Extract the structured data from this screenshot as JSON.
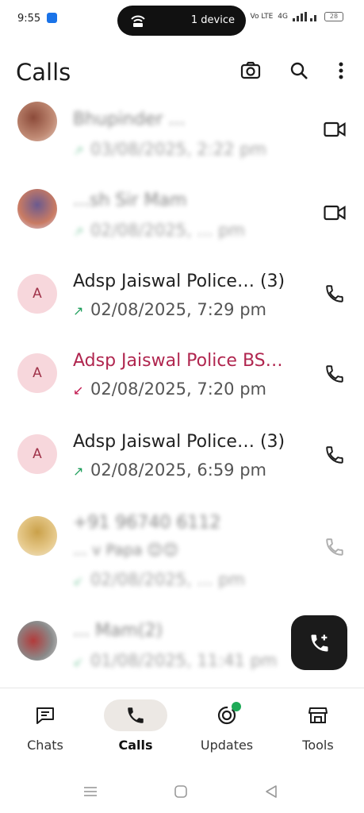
{
  "status_bar": {
    "time": "9:55",
    "pill_label": "1 device",
    "network": "Vo LTE",
    "signal": "4G",
    "battery": "28"
  },
  "app_bar": {
    "title": "Calls",
    "icons": [
      "camera-icon",
      "search-icon",
      "more-vert-icon"
    ]
  },
  "calls": [
    {
      "name": "Bhupinder ...",
      "detail": "03/08/2025, 2:22 pm",
      "type": "outgoing",
      "action": "video",
      "avatar": "photo",
      "obscured": true
    },
    {
      "name": "...sh Sir Mam",
      "detail": "02/08/2025, ... pm",
      "type": "outgoing",
      "action": "video",
      "avatar": "photo",
      "obscured": true
    },
    {
      "name": "Adsp Jaiswal Police… (3)",
      "detail": "02/08/2025, 7:29 pm",
      "type": "outgoing",
      "action": "voice",
      "avatar": "A",
      "obscured": false
    },
    {
      "name": "Adsp Jaiswal Police BS…",
      "detail": "02/08/2025, 7:20 pm",
      "type": "missed",
      "action": "voice",
      "avatar": "A",
      "obscured": false
    },
    {
      "name": "Adsp Jaiswal Police… (3)",
      "detail": "02/08/2025, 6:59 pm",
      "type": "outgoing",
      "action": "voice",
      "avatar": "A",
      "obscured": false
    },
    {
      "name": "+91 96740 6112",
      "subname": "... v Papa 😊😊",
      "detail": "02/08/2025, ... pm",
      "type": "incoming",
      "action": "voice",
      "avatar": "photo",
      "obscured": true
    },
    {
      "name": "... Mam(2)",
      "detail": "01/08/2025, 11:41 pm",
      "type": "incoming",
      "action": "voice",
      "avatar": "photo",
      "obscured": true
    }
  ],
  "fab": {
    "icon": "add-call-icon"
  },
  "bottom_nav": [
    {
      "label": "Chats",
      "icon": "chat-icon",
      "active": false
    },
    {
      "label": "Calls",
      "icon": "phone-icon",
      "active": true
    },
    {
      "label": "Updates",
      "icon": "status-icon",
      "active": false,
      "badge": true
    },
    {
      "label": "Tools",
      "icon": "store-icon",
      "active": false
    }
  ],
  "colors": {
    "missed": "#b0264f",
    "outgoing_arrow": "#1e9e5b",
    "avatar_bg": "#f7d7dc",
    "active_pill": "#ece8e4",
    "badge": "#1eaa57"
  }
}
